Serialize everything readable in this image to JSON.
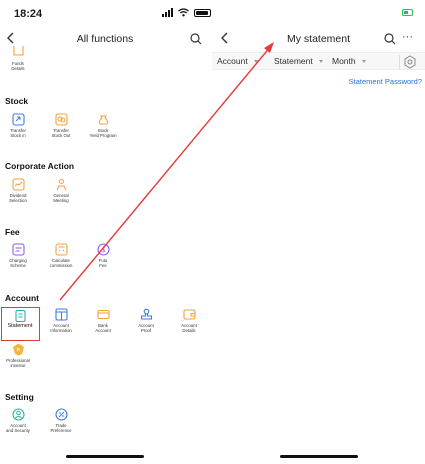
{
  "left": {
    "status_time": "18:24",
    "title": "All functions",
    "top_partial_label": "Funds\nDetails",
    "sections": {
      "stock": {
        "title": "Stock",
        "items": [
          "Transfer\nStock in",
          "Transfer\nStock Out",
          "Stock\nYield Program"
        ]
      },
      "corporate": {
        "title": "Corporate Action",
        "items": [
          "Dividend\nSelection",
          "General\nMeeting"
        ]
      },
      "fee": {
        "title": "Fee",
        "items": [
          "Charging\nScheme",
          "Calculate\ncommission",
          "Futu\nFee"
        ]
      },
      "account": {
        "title": "Account",
        "items": [
          "Statement",
          "Account\nInformation",
          "Bank\nAccount",
          "Account\nProof",
          "Account\nDetails",
          "Professional\ninvestor"
        ]
      },
      "setting": {
        "title": "Setting",
        "items": [
          "Account\nand Security",
          "Trade\nPreference"
        ]
      }
    }
  },
  "right": {
    "title": "My statement",
    "more": "···",
    "filters": [
      "Account",
      "Statement",
      "Month"
    ],
    "link": "Statement Password?"
  },
  "colors": {
    "icon_orange": "#f0a23a",
    "icon_blue": "#3f7de0",
    "icon_purple": "#8a5cf0",
    "icon_teal": "#2bb3a2",
    "highlight": "#e63a3a",
    "link": "#2a6fd6"
  }
}
